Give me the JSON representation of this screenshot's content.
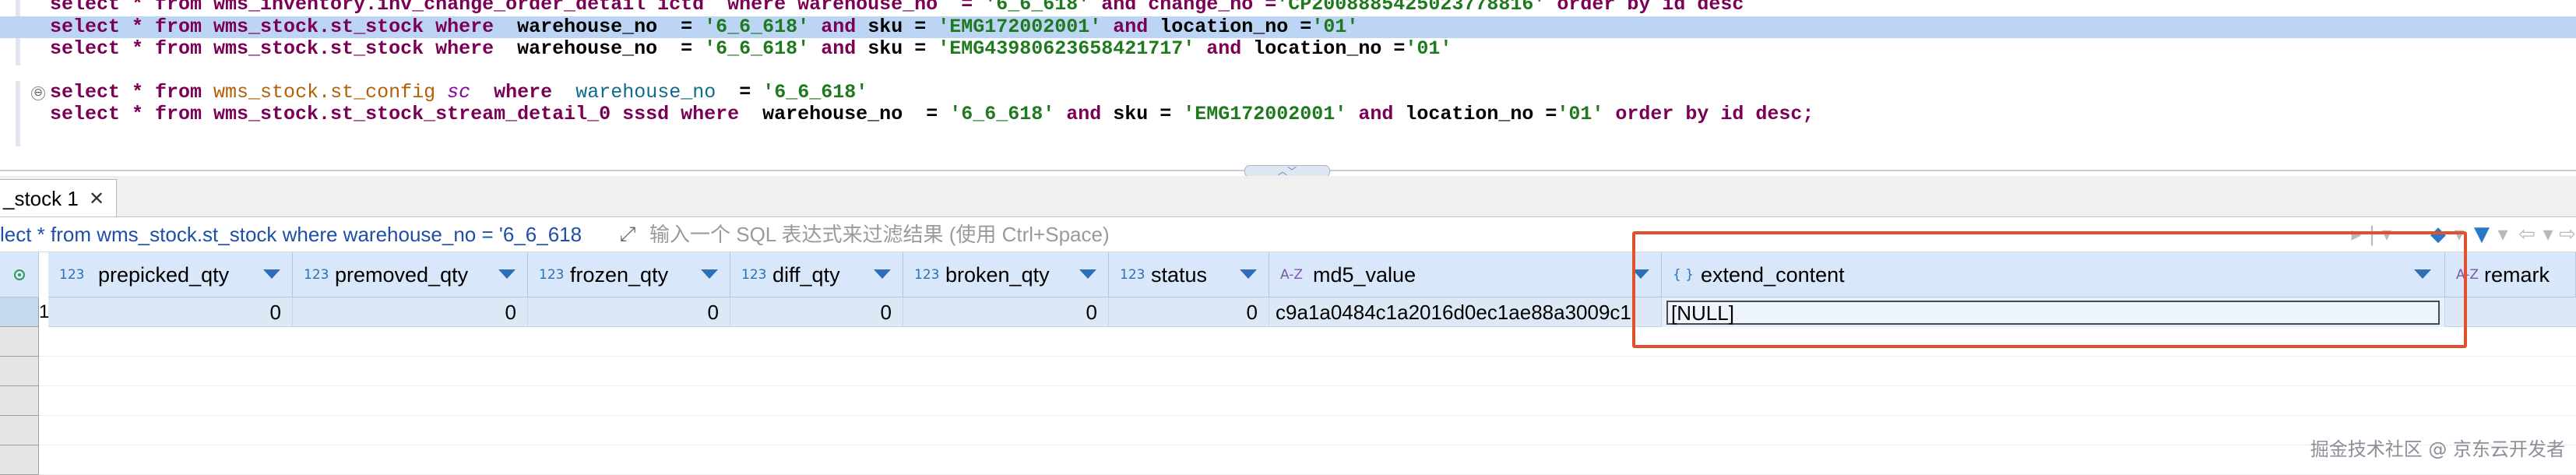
{
  "editor": {
    "lines": [
      {
        "pre": "select * from wms_inventory.inv_change_order_detail ictd  where warehouse_no  = ",
        "s1": "'6_6_618'",
        "mid": " and change_no =",
        "s2": "'CP2008885425023778816'",
        "post": " order by id desc"
      },
      {
        "pre": "select * from wms_stock.st_stock ",
        "kw": "where",
        "mid1": "  warehouse_no  = ",
        "s1": "'6_6_618'",
        "and1": " and ",
        "mid2": "sku = ",
        "s2": "'EMG172002001'",
        "and2": " and ",
        "mid3": "location_no =",
        "s3": "'01'"
      },
      {
        "pre": "select * from wms_stock.st_stock ",
        "kw": "where",
        "mid1": "  warehouse_no  = ",
        "s1": "'6_6_618'",
        "and1": " and ",
        "mid2": "sku = ",
        "s2": "'EMG43980623658421717'",
        "and2": " and ",
        "mid3": "location_no =",
        "s3": "'01'"
      },
      {
        "pre": "select * from ",
        "schema": "wms_stock.",
        "table": "st_config",
        "alias": "sc",
        "kw": "where",
        "col": "warehouse_no",
        "eq": "  = ",
        "s1": "'6_6_618'"
      },
      {
        "pre": "select * from wms_stock.st_stock_stream_detail_0 sssd ",
        "kw": "where",
        "mid1": "  warehouse_no  = ",
        "s1": "'6_6_618'",
        "and1": " and ",
        "mid2": "sku = ",
        "s2": "'EMG172002001'",
        "and2": " and ",
        "mid3": "location_no =",
        "s3": "'01'",
        "post": " order by id desc;"
      }
    ],
    "fold_symbol": "⊖",
    "splitter_grip": "︿﹀"
  },
  "results_tab": {
    "label": "_stock 1",
    "close": "✕"
  },
  "filter": {
    "sql": "lect * from wms_stock.st_stock where warehouse_no = '6_6_618",
    "expand_icon": "⤢",
    "placeholder": "输入一个 SQL 表达式来过滤结果 (使用 Ctrl+Space)",
    "icons": [
      "▸",
      "|",
      "▾",
      "◆",
      "▾",
      "▼",
      "▾",
      "⇦",
      "▾",
      "⇨"
    ]
  },
  "grid": {
    "columns": [
      {
        "type": "123",
        "name": "prepicked_qty"
      },
      {
        "type": "123",
        "name": "premoved_qty"
      },
      {
        "type": "123",
        "name": "frozen_qty"
      },
      {
        "type": "123",
        "name": "diff_qty"
      },
      {
        "type": "123",
        "name": "broken_qty"
      },
      {
        "type": "123",
        "name": "status"
      },
      {
        "type": "A-Z",
        "name": "md5_value"
      },
      {
        "type": "{ }",
        "name": "extend_content"
      },
      {
        "type": "A-Z",
        "name": "remark"
      }
    ],
    "row": {
      "num": "1",
      "values": [
        "0",
        "0",
        "0",
        "0",
        "0",
        "0",
        "c9a1a0484c1a2016d0ec1ae88a3009c1",
        "[NULL]",
        ""
      ]
    }
  },
  "watermark": "掘金技术社区 @ 京东云开发者",
  "colors": {
    "highlight": "#e0522e",
    "header": "#d8e7f9",
    "selected_row": "#dce8f6",
    "string": "#1f7a1f",
    "keyword": "#7b0055"
  }
}
